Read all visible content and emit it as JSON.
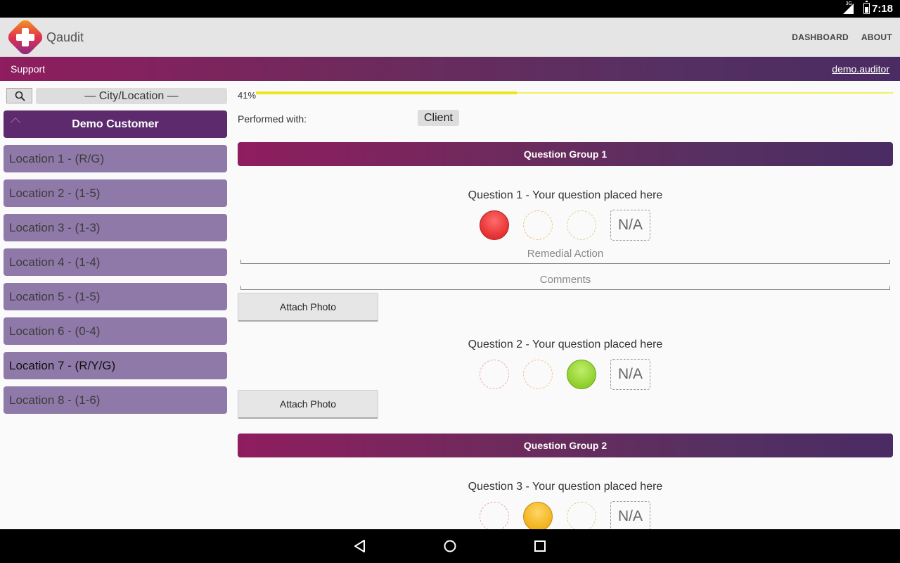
{
  "status_bar": {
    "network": "3G",
    "time": "7:18",
    "battery_icon": "battery-icon",
    "signal_icon": "signal-icon"
  },
  "app_bar": {
    "title": "Qaudit",
    "nav": {
      "dashboard": "DASHBOARD",
      "about": "ABOUT"
    }
  },
  "banner": {
    "support": "Support",
    "user": "demo.auditor"
  },
  "sidebar": {
    "city_filter": "— City/Location —",
    "customer": "Demo Customer",
    "locations": [
      {
        "label": "Location 1 - (R/G)",
        "selected": false
      },
      {
        "label": "Location 2 - (1-5)",
        "selected": false
      },
      {
        "label": "Location 3 - (1-3)",
        "selected": false
      },
      {
        "label": "Location 4 - (1-4)",
        "selected": false
      },
      {
        "label": "Location 5 - (1-5)",
        "selected": false
      },
      {
        "label": "Location 6 - (0-4)",
        "selected": false
      },
      {
        "label": "Location 7 - (R/Y/G)",
        "selected": true
      },
      {
        "label": "Location 8 - (1-6)",
        "selected": false
      }
    ]
  },
  "audit": {
    "progress": {
      "label": "41%",
      "value": 0.41
    },
    "performed_with": {
      "label": "Performed with:",
      "value": "Client"
    },
    "groups": [
      {
        "title": "Question Group 1"
      },
      {
        "title": "Question Group 2"
      }
    ],
    "questions": [
      {
        "text": "Question 1 - Your question placed here",
        "selected": "red",
        "na_label": "N/A",
        "remedial_label": "Remedial Action",
        "comments_label": "Comments",
        "attach_label": "Attach Photo"
      },
      {
        "text": "Question 2 - Your question placed here",
        "selected": "green",
        "na_label": "N/A",
        "attach_label": "Attach Photo"
      },
      {
        "text": "Question 3 - Your question placed here",
        "selected": "yellow",
        "na_label": "N/A"
      }
    ]
  },
  "colors": {
    "accent_start": "#8f1d5f",
    "accent_end": "#4a2b63",
    "location_bg": "#8f79a9",
    "customer_bg": "#5c2a6d",
    "red": "#e53030",
    "yellow": "#f1b21c",
    "green": "#8ecf2a",
    "progress": "#ece61e"
  }
}
